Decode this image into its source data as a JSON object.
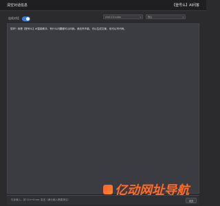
{
  "header": {
    "title": "清空对话信息",
    "brand": "【登号么】AI问答"
  },
  "controls": {
    "toggle_label": "连续对话",
    "model_select": "chat-3.5-turbo",
    "mode_select": "默认"
  },
  "chat": {
    "first_message": "您好！我是【登号么】AI智能助手，有什么问题都可以问我。我无所不能，可以生成文案，也可以写代码。"
  },
  "input": {
    "placeholder": "在此输入，按 Ctrl+Enter 发送（满分输入需要清空）",
    "send_label": "发送"
  },
  "watermark": {
    "text": "亿动网址导航"
  },
  "colors": {
    "accent": "#3a7be0",
    "watermark": "#ff6a2a"
  }
}
